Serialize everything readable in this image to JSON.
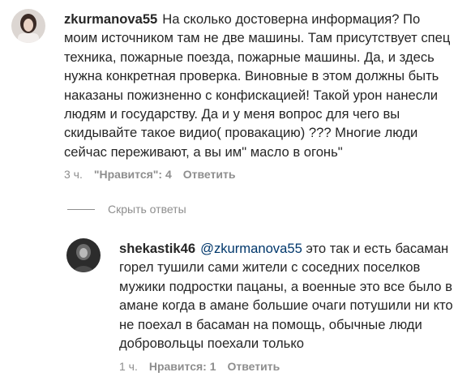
{
  "comment1": {
    "username": "zkurmanova55",
    "text": "На сколько достоверна информация? По моим источником там не две машины. Там присутствует спец техника, пожарные поезда, пожарные машины. Да, и здесь нужна конкретная проверка. Виновные в этом должны быть наказаны пожизненно с конфискацией! Такой урон нанесли людям и государству. Да и у меня вопрос для чего вы скидывайте такое видио( провакацию) ??? Многие люди сейчас переживают, а вы им\" масло в огонь\"",
    "time": "3 ч.",
    "likes": "\"Нравится\": 4",
    "reply": "Ответить"
  },
  "hide_replies": "Скрыть ответы",
  "reply1": {
    "username": "shekastik46",
    "mention": "@zkurmanova55",
    "text": " это так и есть басаман горел тушили сами жители с соседних поселков мужики подростки пацаны, а военные это все было в амане когда в амане большие очаги потушили ни кто не поехал в басаман на помощь, обычные люди добровольцы поехали только",
    "time": "1 ч.",
    "likes": "Нравится: 1",
    "reply": "Ответить"
  }
}
